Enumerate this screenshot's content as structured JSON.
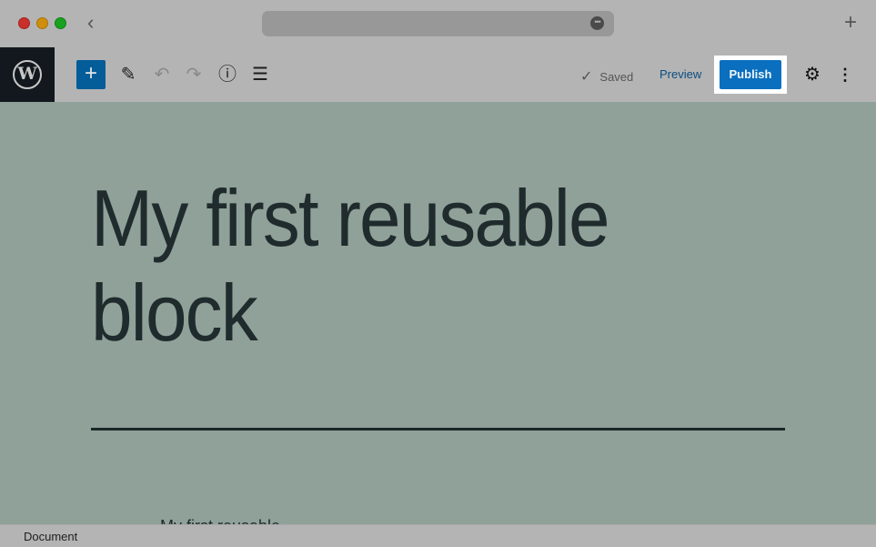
{
  "browser": {
    "back_icon": "chevron-left-icon",
    "url_more_icon": "ellipsis-icon",
    "new_tab_icon": "plus-icon",
    "url_more_glyph": "•••",
    "back_glyph": "‹",
    "new_tab_glyph": "+"
  },
  "toolbar": {
    "logo_glyph": "W",
    "add_block_glyph": "+",
    "edit_glyph": "✎",
    "undo_glyph": "↶",
    "redo_glyph": "↷",
    "info_glyph": "ⓘ",
    "list_view_glyph": "☰",
    "saved_check_glyph": "✓",
    "saved_label": "Saved",
    "preview_label": "Preview",
    "publish_label": "Publish",
    "settings_glyph": "⚙",
    "more_glyph": "⋮",
    "colors": {
      "publish": "#0a6fbf",
      "add_block": "#045c98",
      "preview": "#0a4d80"
    }
  },
  "editor": {
    "title": "My first reusable block",
    "body_text_partial": "My first reusable..."
  },
  "footer": {
    "breadcrumb": "Document"
  }
}
